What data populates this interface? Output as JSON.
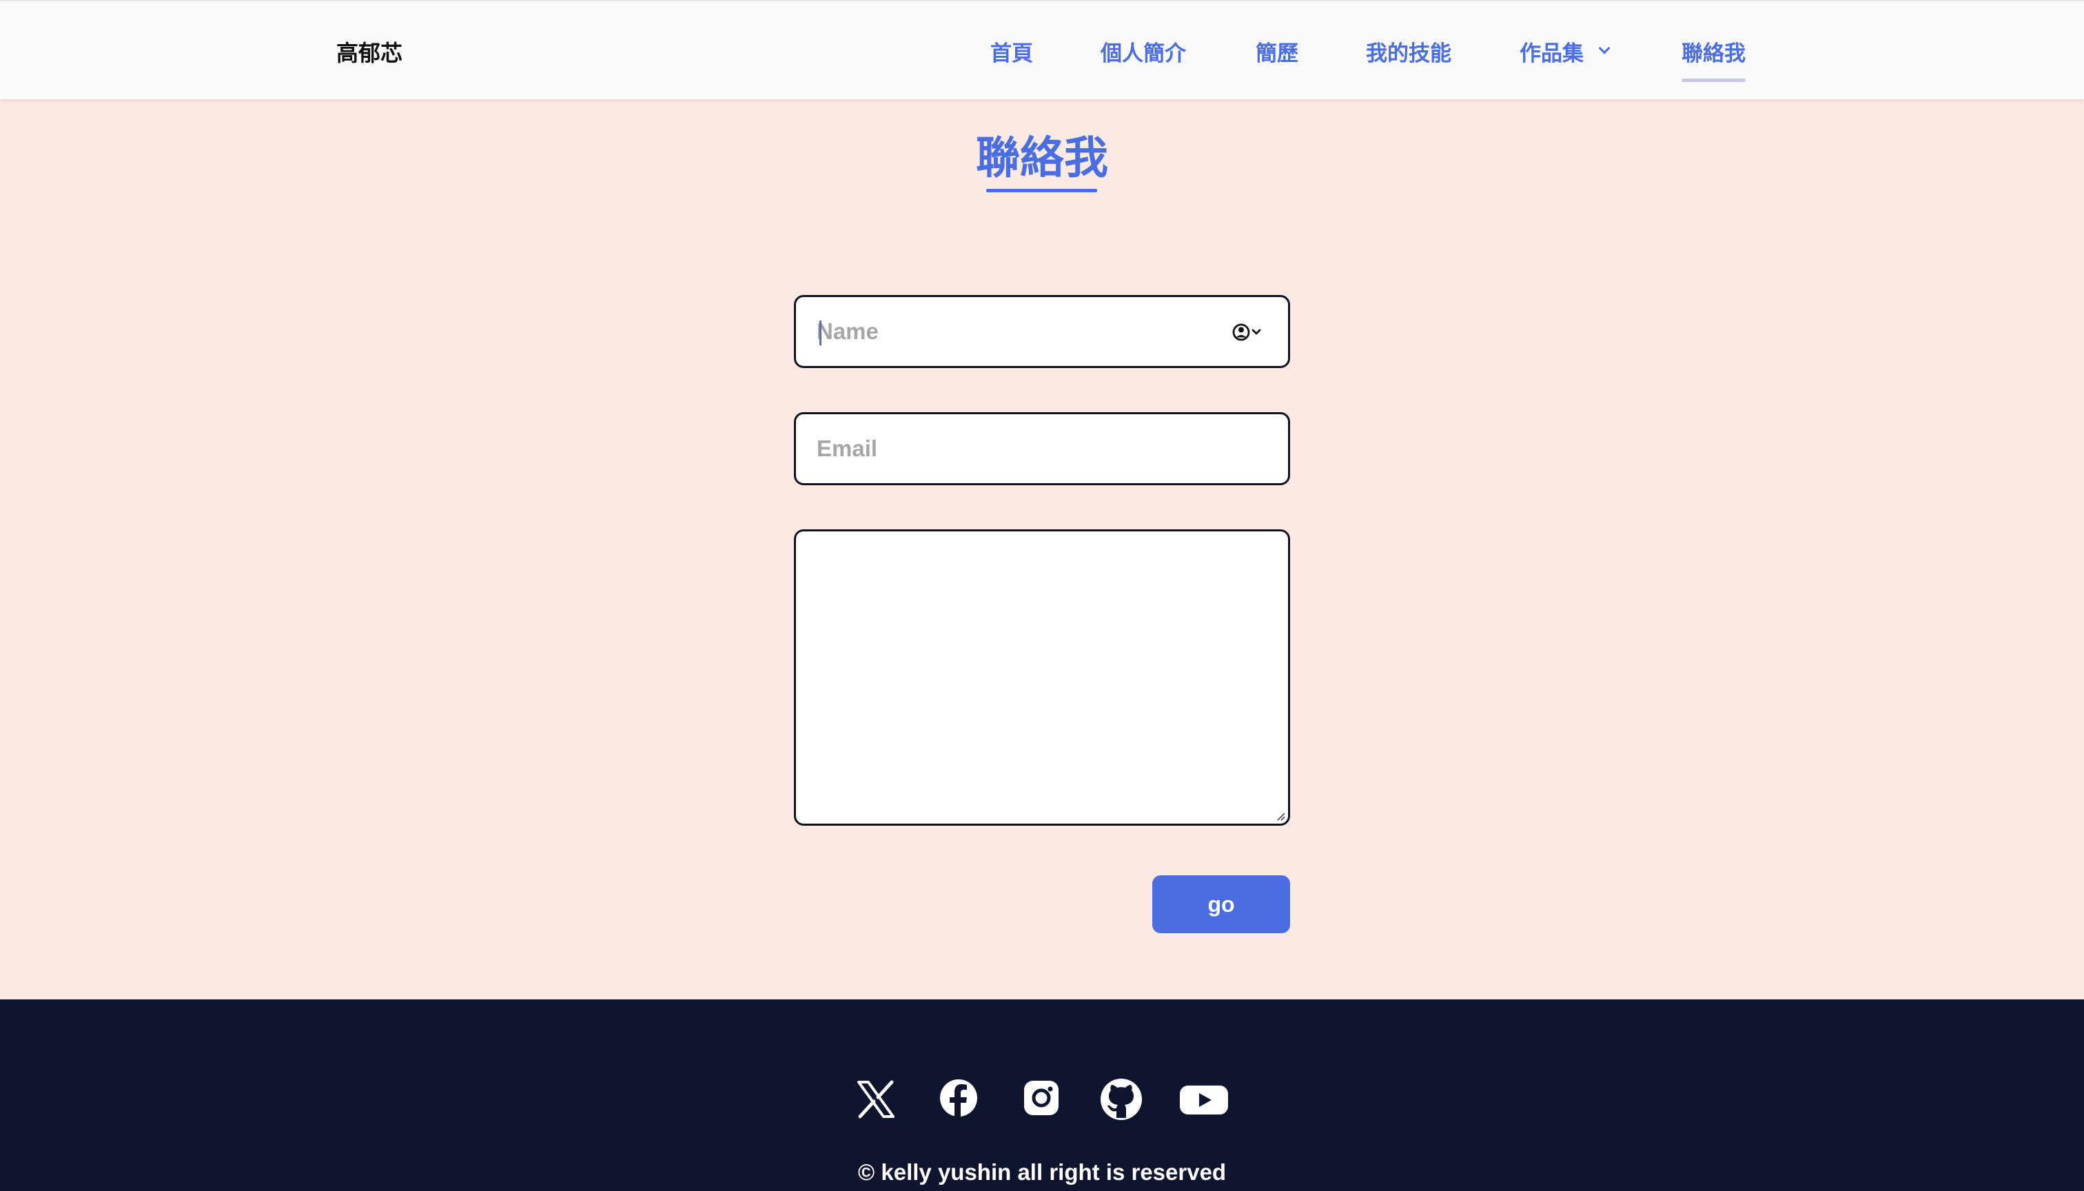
{
  "header": {
    "brand": "高郁芯",
    "nav": [
      {
        "label": "首頁"
      },
      {
        "label": "個人簡介"
      },
      {
        "label": "簡歷"
      },
      {
        "label": "我的技能"
      },
      {
        "label": "作品集",
        "has_dropdown": true
      },
      {
        "label": "聯絡我",
        "active": true
      }
    ]
  },
  "contact": {
    "title": "聯絡我",
    "name_placeholder": "Name",
    "email_placeholder": "Email",
    "message_placeholder": "",
    "submit_label": "go"
  },
  "footer": {
    "social_icons": [
      "x-icon",
      "facebook-icon",
      "instagram-icon",
      "github-icon",
      "youtube-icon"
    ],
    "copyright": "© kelly yushin all right is reserved"
  },
  "colors": {
    "accent": "#4a6ee0",
    "page_background": "#fbe9e3",
    "footer_background": "#0f152e"
  }
}
